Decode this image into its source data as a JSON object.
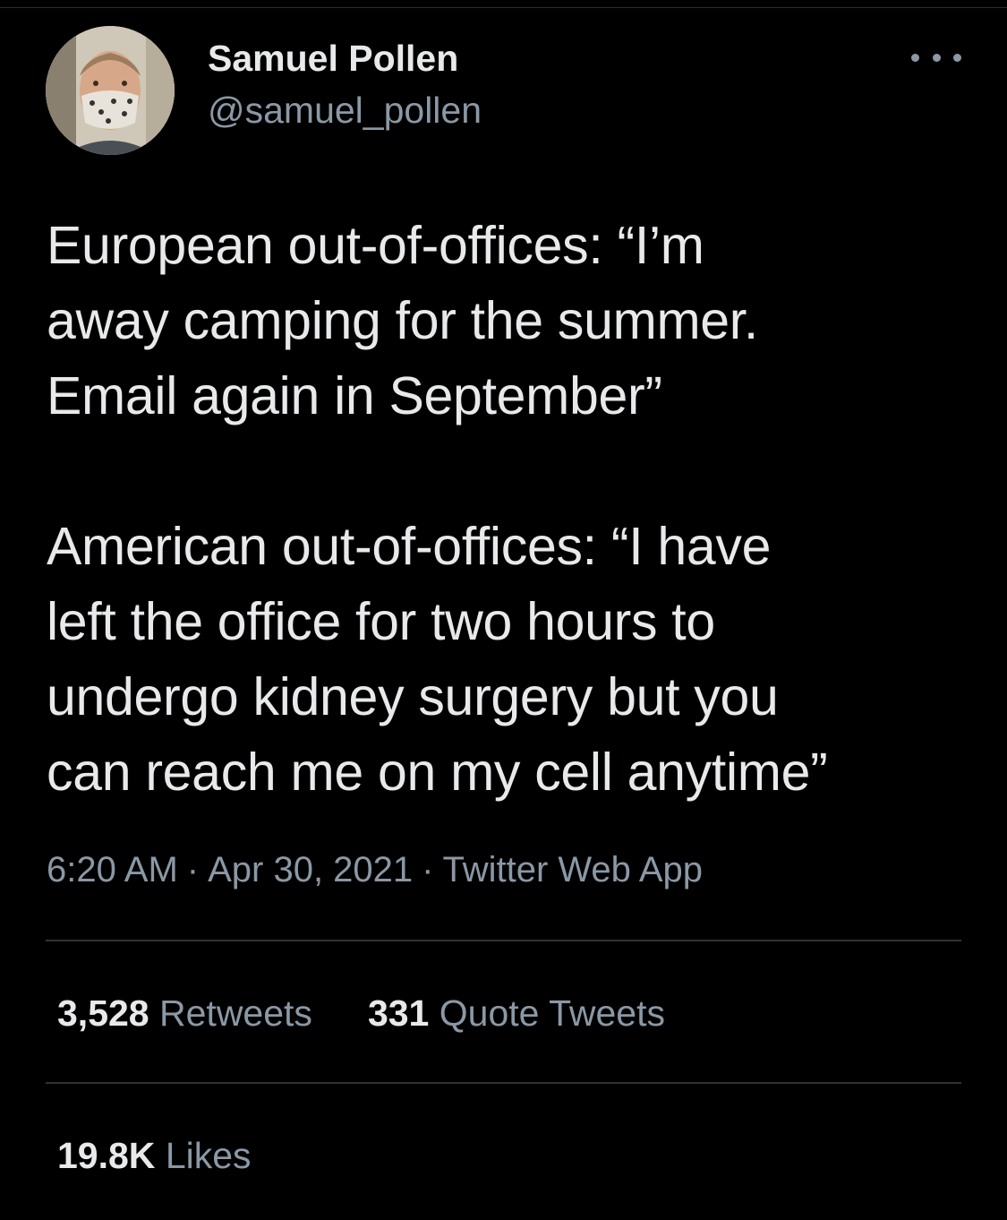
{
  "user": {
    "display_name": "Samuel Pollen",
    "handle": "@samuel_pollen"
  },
  "tweet": {
    "text": "European out-of-offices: “I’m\naway camping for the summer.\nEmail again in September”\n\nAmerican out-of-offices: “I have\nleft the office for two hours to\nundergo kidney surgery but you\ncan reach me on my cell anytime”"
  },
  "meta": {
    "time": "6:20 AM",
    "separator": "·",
    "date": "Apr 30, 2021",
    "source": "Twitter Web App"
  },
  "stats": {
    "retweets_count": "3,528",
    "retweets_label": "Retweets",
    "quotes_count": "331",
    "quotes_label": "Quote Tweets",
    "likes_count": "19.8K",
    "likes_label": "Likes"
  },
  "icons": {
    "more": "more-horizontal-icon"
  },
  "colors": {
    "background": "#000000",
    "primary_text": "#e7e9ea",
    "secondary_text": "#8b98a5",
    "divider": "#2f3336"
  }
}
